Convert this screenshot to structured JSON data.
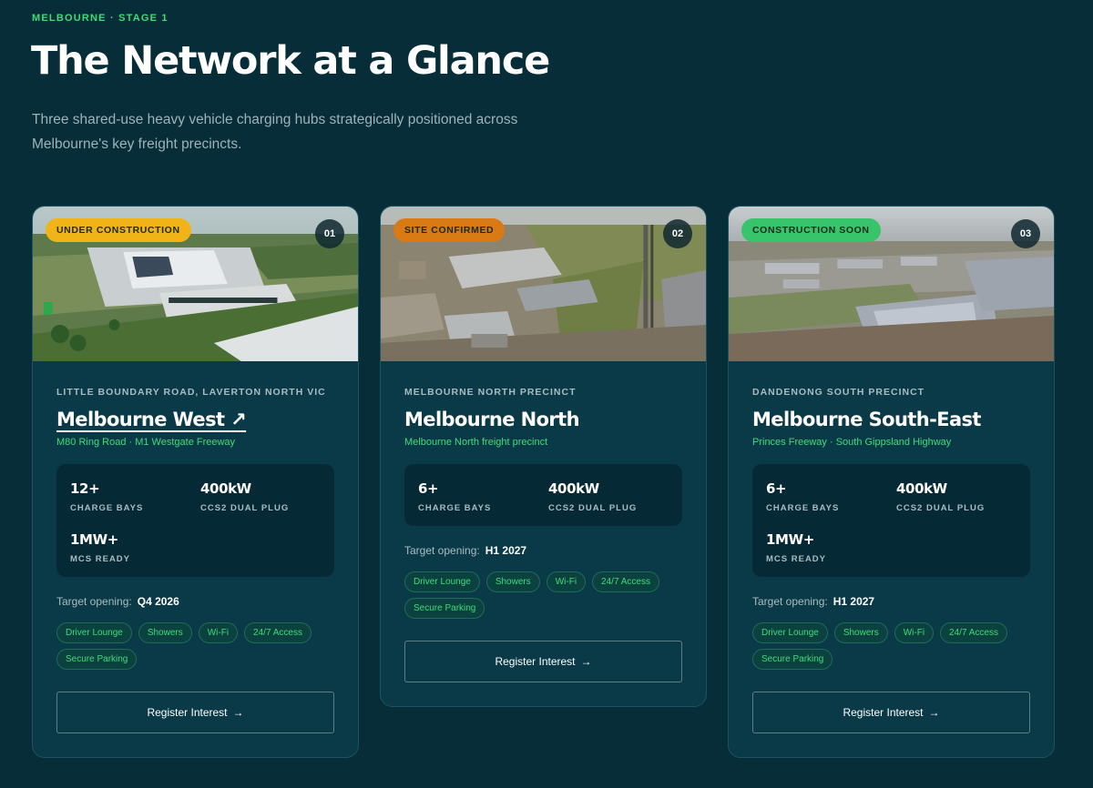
{
  "header": {
    "eyebrow": "MELBOURNE · STAGE 1",
    "title": "The Network at a Glance",
    "subtitle": "Three shared-use heavy vehicle charging hubs strategically positioned across Melbourne's key freight precincts."
  },
  "colors": {
    "background": "#062d38",
    "card": "#0a3a48",
    "accent_green": "#3fdc78",
    "status_under_construction": "#f0b419",
    "status_site_confirmed": "#d97a14",
    "status_construction_soon": "#38c46a"
  },
  "hubs": [
    {
      "status": "UNDER CONSTRUCTION",
      "number": "01",
      "location": "LITTLE BOUNDARY ROAD, LAVERTON NORTH VIC",
      "name": "Melbourne West",
      "link_icon": "↗",
      "roads": "M80 Ring Road · M1 Westgate Freeway",
      "stats": [
        {
          "value": "12+",
          "label": "CHARGE BAYS"
        },
        {
          "value": "400kW",
          "label": "CCS2 DUAL PLUG"
        },
        {
          "value": "1MW+",
          "label": "MCS READY"
        }
      ],
      "opening_label": "Target opening:",
      "opening_value": "Q4 2026",
      "amenities": [
        "Driver Lounge",
        "Showers",
        "Wi-Fi",
        "24/7 Access",
        "Secure Parking"
      ],
      "button": "Register Interest",
      "button_arrow": "→"
    },
    {
      "status": "SITE CONFIRMED",
      "number": "02",
      "location": "MELBOURNE NORTH PRECINCT",
      "name": "Melbourne North",
      "roads": "Melbourne North freight precinct",
      "stats": [
        {
          "value": "6+",
          "label": "CHARGE BAYS"
        },
        {
          "value": "400kW",
          "label": "CCS2 DUAL PLUG"
        }
      ],
      "opening_label": "Target opening:",
      "opening_value": "H1 2027",
      "amenities": [
        "Driver Lounge",
        "Showers",
        "Wi-Fi",
        "24/7 Access",
        "Secure Parking"
      ],
      "button": "Register Interest",
      "button_arrow": "→"
    },
    {
      "status": "CONSTRUCTION SOON",
      "number": "03",
      "location": "DANDENONG SOUTH PRECINCT",
      "name": "Melbourne South-East",
      "roads": "Princes Freeway · South Gippsland Highway",
      "stats": [
        {
          "value": "6+",
          "label": "CHARGE BAYS"
        },
        {
          "value": "400kW",
          "label": "CCS2 DUAL PLUG"
        },
        {
          "value": "1MW+",
          "label": "MCS READY"
        }
      ],
      "opening_label": "Target opening:",
      "opening_value": "H1 2027",
      "amenities": [
        "Driver Lounge",
        "Showers",
        "Wi-Fi",
        "24/7 Access",
        "Secure Parking"
      ],
      "button": "Register Interest",
      "button_arrow": "→"
    }
  ]
}
